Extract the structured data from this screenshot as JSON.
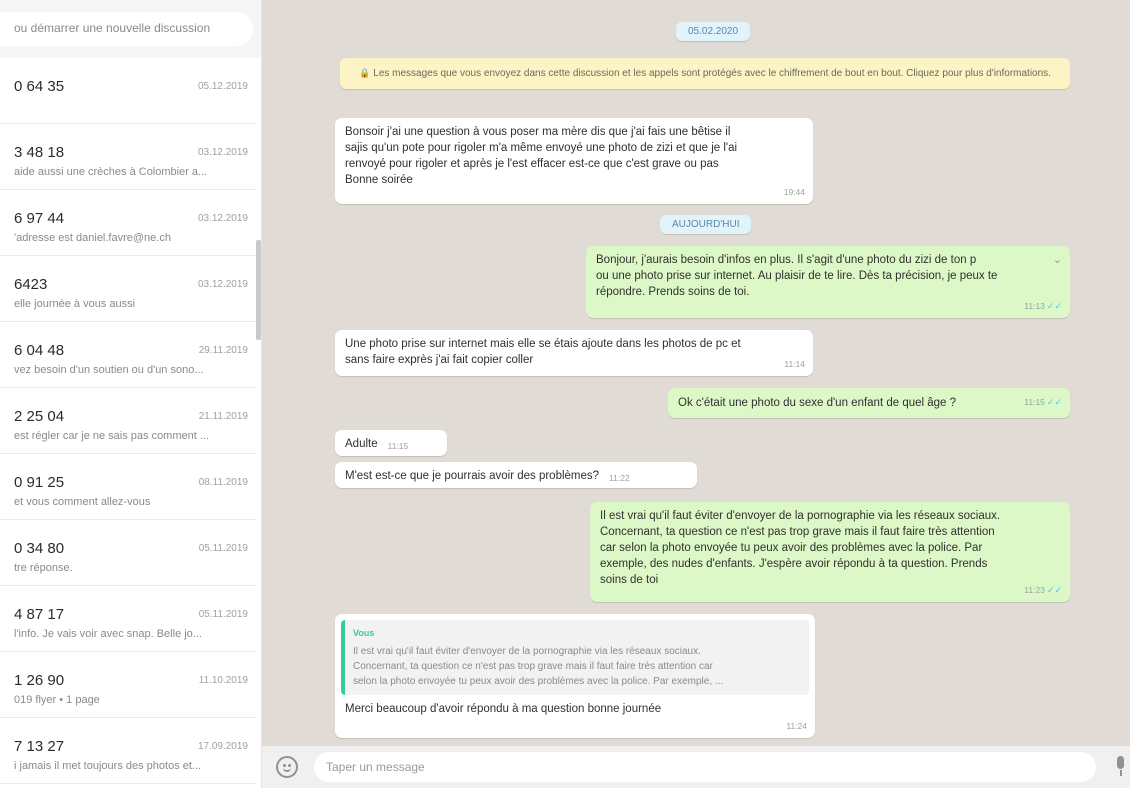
{
  "sidebar": {
    "search_placeholder": "ou démarrer une nouvelle discussion",
    "chats": [
      {
        "name": "0 64 35",
        "date": "05.12.2019",
        "preview": ""
      },
      {
        "name": "3 48 18",
        "date": "03.12.2019",
        "preview": "aide aussi une crèches à Colombier a..."
      },
      {
        "name": "6 97 44",
        "date": "03.12.2019",
        "preview": "'adresse est daniel.favre@ne.ch"
      },
      {
        "name": "6423",
        "date": "03.12.2019",
        "preview": "elle journée à vous aussi"
      },
      {
        "name": "6 04 48",
        "date": "29.11.2019",
        "preview": "vez besoin d'un soutien ou d'un sono..."
      },
      {
        "name": "2 25 04",
        "date": "21.11.2019",
        "preview": "est régler car je ne sais pas comment ..."
      },
      {
        "name": "0 91 25",
        "date": "08.11.2019",
        "preview": "et vous comment allez-vous"
      },
      {
        "name": "0 34 80",
        "date": "05.11.2019",
        "preview": "tre réponse."
      },
      {
        "name": "4 87 17",
        "date": "05.11.2019",
        "preview": "l'info. Je vais voir avec snap. Belle jo..."
      },
      {
        "name": "1 26 90",
        "date": "11.10.2019",
        "preview": "019 flyer • 1 page"
      },
      {
        "name": "7 13 27",
        "date": "17.09.2019",
        "preview": "i jamais il met toujours des photos et..."
      }
    ]
  },
  "chat": {
    "date_chip": "05.02.2020",
    "today_chip": "AUJOURD'HUI",
    "encryption_notice": "Les messages que vous envoyez dans cette discussion et les appels sont protégés avec le chiffrement de bout en bout. Cliquez pour plus d'informations.",
    "messages": [
      {
        "dir": "in",
        "text": "Bonsoir j'ai une question à vous poser ma mère dis que j'ai fais une bêtise il\nsajis qu'un pote pour rigoler m'a même envoyé une photo de zizi et que je l'ai\nrenvoyé pour rigoler et après je l'est effacer est-ce que c'est grave ou pas\nBonne soirée",
        "time": "19:44"
      },
      {
        "dir": "out",
        "text": "Bonjour, j'aurais besoin d'infos en plus. Il s'agit d'une photo du zizi de ton p\nou une photo prise sur internet. Au plaisir de te lire. Dès ta précision, je peux te\nrépondre. Prends soins de toi.",
        "time": "11:13"
      },
      {
        "dir": "in",
        "text": "Une photo prise sur internet mais elle se étais ajoute dans les photos de pc et\nsans faire exprès j'ai fait copier coller",
        "time": "11:14"
      },
      {
        "dir": "out",
        "text": "Ok c'était une photo du sexe d'un enfant de quel âge ?",
        "time": "11:15"
      },
      {
        "dir": "in",
        "text": "Adulte",
        "time": "11:15"
      },
      {
        "dir": "in",
        "text": "M'est est-ce que je pourrais avoir des problèmes?",
        "time": "11:22"
      },
      {
        "dir": "out",
        "text": "Il est vrai qu'il faut éviter d'envoyer de la pornographie via les réseaux sociaux.\nConcernant, ta question ce n'est pas trop grave mais il faut faire très attention\ncar selon la photo envoyée tu peux avoir des problèmes avec la police. Par\nexemple, des nudes d'enfants. J'espère avoir répondu à ta question. Prends\nsoins de toi",
        "time": "11:23"
      },
      {
        "dir": "in",
        "text": "Merci beaucoup d'avoir répondu à ma question bonne journée",
        "time": "11:24"
      }
    ],
    "quote": {
      "author": "Vous",
      "text": "Il est vrai qu'il faut éviter d'envoyer de la pornographie via les réseaux sociaux.\nConcernant, ta question ce n'est pas trop grave mais il faut faire très attention car\nselon la photo envoyée tu peux avoir des problèmes avec la police. Par exemple, ..."
    }
  },
  "compose": {
    "placeholder": "Taper un message",
    "emoji_icon": "emoji-icon",
    "mic_icon": "microphone-icon"
  }
}
